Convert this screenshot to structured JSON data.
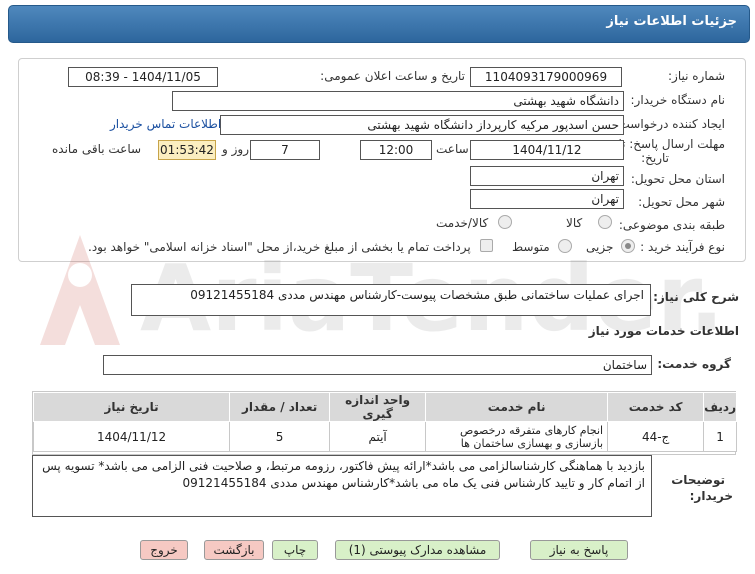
{
  "header": {
    "title": "جزئیات اطلاعات نیاز"
  },
  "form": {
    "need_number_label": "شماره نیاز:",
    "need_number": "1104093179000969",
    "announce_label": "تاریخ و ساعت اعلان عمومی:",
    "announce_value": "1404/11/05 - 08:39",
    "buyer_org_label": "نام دستگاه خریدار:",
    "buyer_org": "دانشگاه شهید بهشتی",
    "requester_label": "ایجاد کننده درخواست:",
    "requester": "حسن اسدپور مرکیه کارپرداز دانشگاه شهید بهشتی",
    "contact_link": "اطلاعات تماس خریدار",
    "deadline_label_1": "مهلت ارسال پاسخ: تا",
    "deadline_label_2": "تاریخ:",
    "deadline_date": "1404/11/12",
    "hour_label": "ساعت",
    "deadline_time": "12:00",
    "days": "7",
    "days_label": "روز و",
    "remaining": "01:53:42",
    "remaining_label": "ساعت باقی مانده",
    "province_label": "استان محل تحویل:",
    "province": "تهران",
    "city_label": "شهر محل تحویل:",
    "city": "تهران",
    "category_label": "طبقه بندی موضوعی:",
    "category_options": [
      "کالا",
      "کالا/خدمت"
    ],
    "purchase_type_label": "نوع فرآیند خرید :",
    "purchase_type_options": [
      "جزیی",
      "متوسط"
    ],
    "treasury_note": "پرداخت تمام یا بخشی از مبلغ خرید،از محل \"اسناد خزانه اسلامی\" خواهد بود."
  },
  "description": {
    "label": "شرح کلی نیاز:",
    "text": "اجرای عملیات ساختمانی طبق مشخصات پیوست-کارشناس مهندس مددی 09121455184"
  },
  "services": {
    "section_title": "اطلاعات خدمات مورد نیاز",
    "group_label": "گروه خدمت:",
    "group_value": "ساختمان",
    "columns": [
      "ردیف",
      "کد خدمت",
      "نام خدمت",
      "واحد اندازه گیری",
      "تعداد / مقدار",
      "تاریخ نیاز"
    ],
    "rows": [
      [
        "1",
        "ج-44",
        "انجام کارهای متفرقه درخصوص بازسازی و بهسازی ساختمان ها",
        "آیتم",
        "5",
        "1404/11/12"
      ]
    ]
  },
  "buyer_notes": {
    "label_1": "توضیحات",
    "label_2": "خریدار:",
    "text": "بازدید با هماهنگی کارشناسالزامی می باشد*ارائه پیش فاکتور، رزومه مرتبط، و صلاحیت فنی الزامی می باشد* تسویه پس از اتمام کار و تایید کارشناس فنی یک ماه می باشد*کارشناس مهندس مددی 09121455184"
  },
  "buttons": {
    "reply": "پاسخ به نیاز",
    "attachments": "مشاهده مدارک پیوستی (1)",
    "print": "چاپ",
    "back": "بازگشت",
    "exit": "خروج"
  },
  "watermark": {
    "text": "AriaTender.net"
  },
  "colors": {
    "header": "#3a75ae",
    "remaining_bg": "#fbeec0",
    "button_green": "#d8f0c8",
    "button_red": "#f6c9c3",
    "watermark": "#c0392b"
  }
}
